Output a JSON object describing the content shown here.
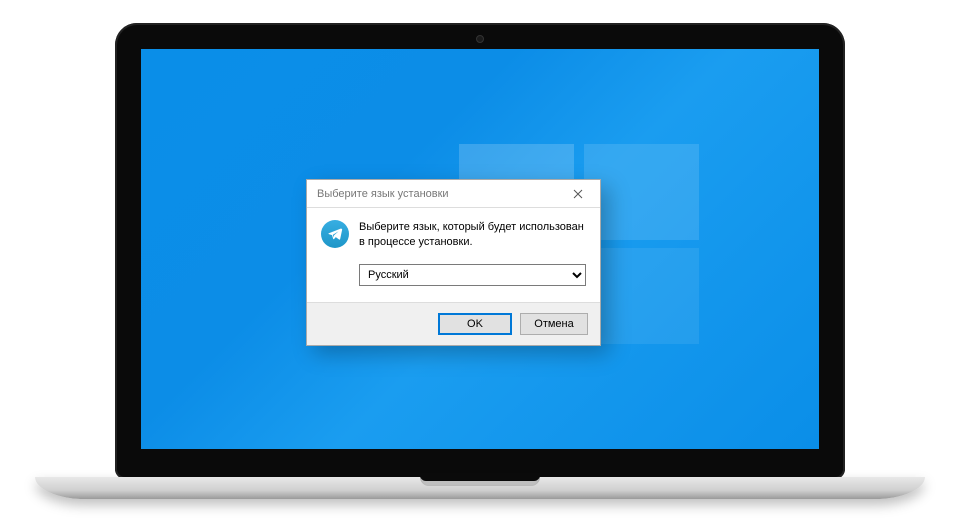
{
  "dialog": {
    "title": "Выберите язык установки",
    "message": "Выберите язык, который будет использован в процессе установки.",
    "language_selected": "Русский",
    "ok_label": "OK",
    "cancel_label": "Отмена"
  }
}
